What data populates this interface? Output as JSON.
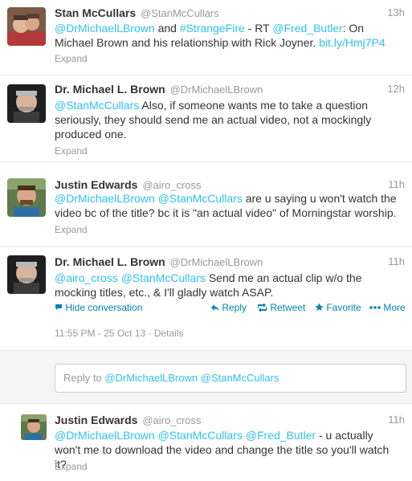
{
  "tweets": [
    {
      "fullname": "Stan McCullars",
      "username": "@StanMcCullars",
      "time": "13h",
      "segments": [
        {
          "t": "@DrMichaelLBrown",
          "link": true
        },
        {
          "t": " and ",
          "link": false
        },
        {
          "t": "#StrangeFire",
          "link": true
        },
        {
          "t": " - RT ",
          "link": false
        },
        {
          "t": "@Fred_Butler",
          "link": true
        },
        {
          "t": ": On Michael Brown and his relationship with Rick Joyner. ",
          "link": false
        },
        {
          "t": "bit.ly/Hmj7P4",
          "link": true
        }
      ],
      "expand": "Expand"
    },
    {
      "fullname": "Dr. Michael L. Brown",
      "username": "@DrMichaelLBrown",
      "time": "12h",
      "segments": [
        {
          "t": "@StanMcCullars",
          "link": true
        },
        {
          "t": " Also, if someone wants me to take a question seriously, they should send me an actual video, not a mockingly produced one.",
          "link": false
        }
      ],
      "expand": "Expand"
    },
    {
      "fullname": "Justin Edwards",
      "username": "@airo_cross",
      "time": "11h",
      "segments": [
        {
          "t": "@DrMichaelLBrown",
          "link": true
        },
        {
          "t": " ",
          "link": false
        },
        {
          "t": "@StanMcCullars",
          "link": true
        },
        {
          "t": " are u saying u won't watch the video bc of the title? bc it is \"an actual video\" of Morningstar worship.",
          "link": false
        }
      ],
      "expand": "Expand"
    },
    {
      "fullname": "Dr. Michael L. Brown",
      "username": "@DrMichaelLBrown",
      "time": "11h",
      "segments": [
        {
          "t": "@airo_cross",
          "link": true
        },
        {
          "t": " ",
          "link": false
        },
        {
          "t": "@StanMcCullars",
          "link": true
        },
        {
          "t": " Send me an actual clip w/o the mocking titles, etc., & I'll gladly watch ASAP.",
          "link": false
        }
      ],
      "actions": {
        "hide": "Hide conversation",
        "reply": "Reply",
        "retweet": "Retweet",
        "favorite": "Favorite",
        "more": "More"
      },
      "meta": "11:55 PM - 25 Oct 13 · Details"
    },
    {
      "fullname": "Justin Edwards",
      "username": "@airo_cross",
      "time": "11h",
      "segments": [
        {
          "t": "@DrMichaelLBrown",
          "link": true
        },
        {
          "t": " ",
          "link": false
        },
        {
          "t": "@StanMcCullars",
          "link": true
        },
        {
          "t": " ",
          "link": false
        },
        {
          "t": "@Fred_Butler",
          "link": true
        },
        {
          "t": " - u actually won't me to download the video and change the title so you'll watch it?",
          "link": false
        }
      ],
      "expand": "Expand"
    }
  ],
  "reply_box": {
    "prefix": "Reply to ",
    "mention1": "@DrMichaelLBrown",
    "mention2": "@StanMcCullars"
  },
  "colors": {
    "link": "#2fc2ef",
    "action": "#0084b4",
    "muted": "#999999",
    "name": "#333333"
  },
  "icons": [
    "hide-conversation-icon",
    "reply-icon",
    "retweet-icon",
    "favorite-icon",
    "more-icon"
  ]
}
